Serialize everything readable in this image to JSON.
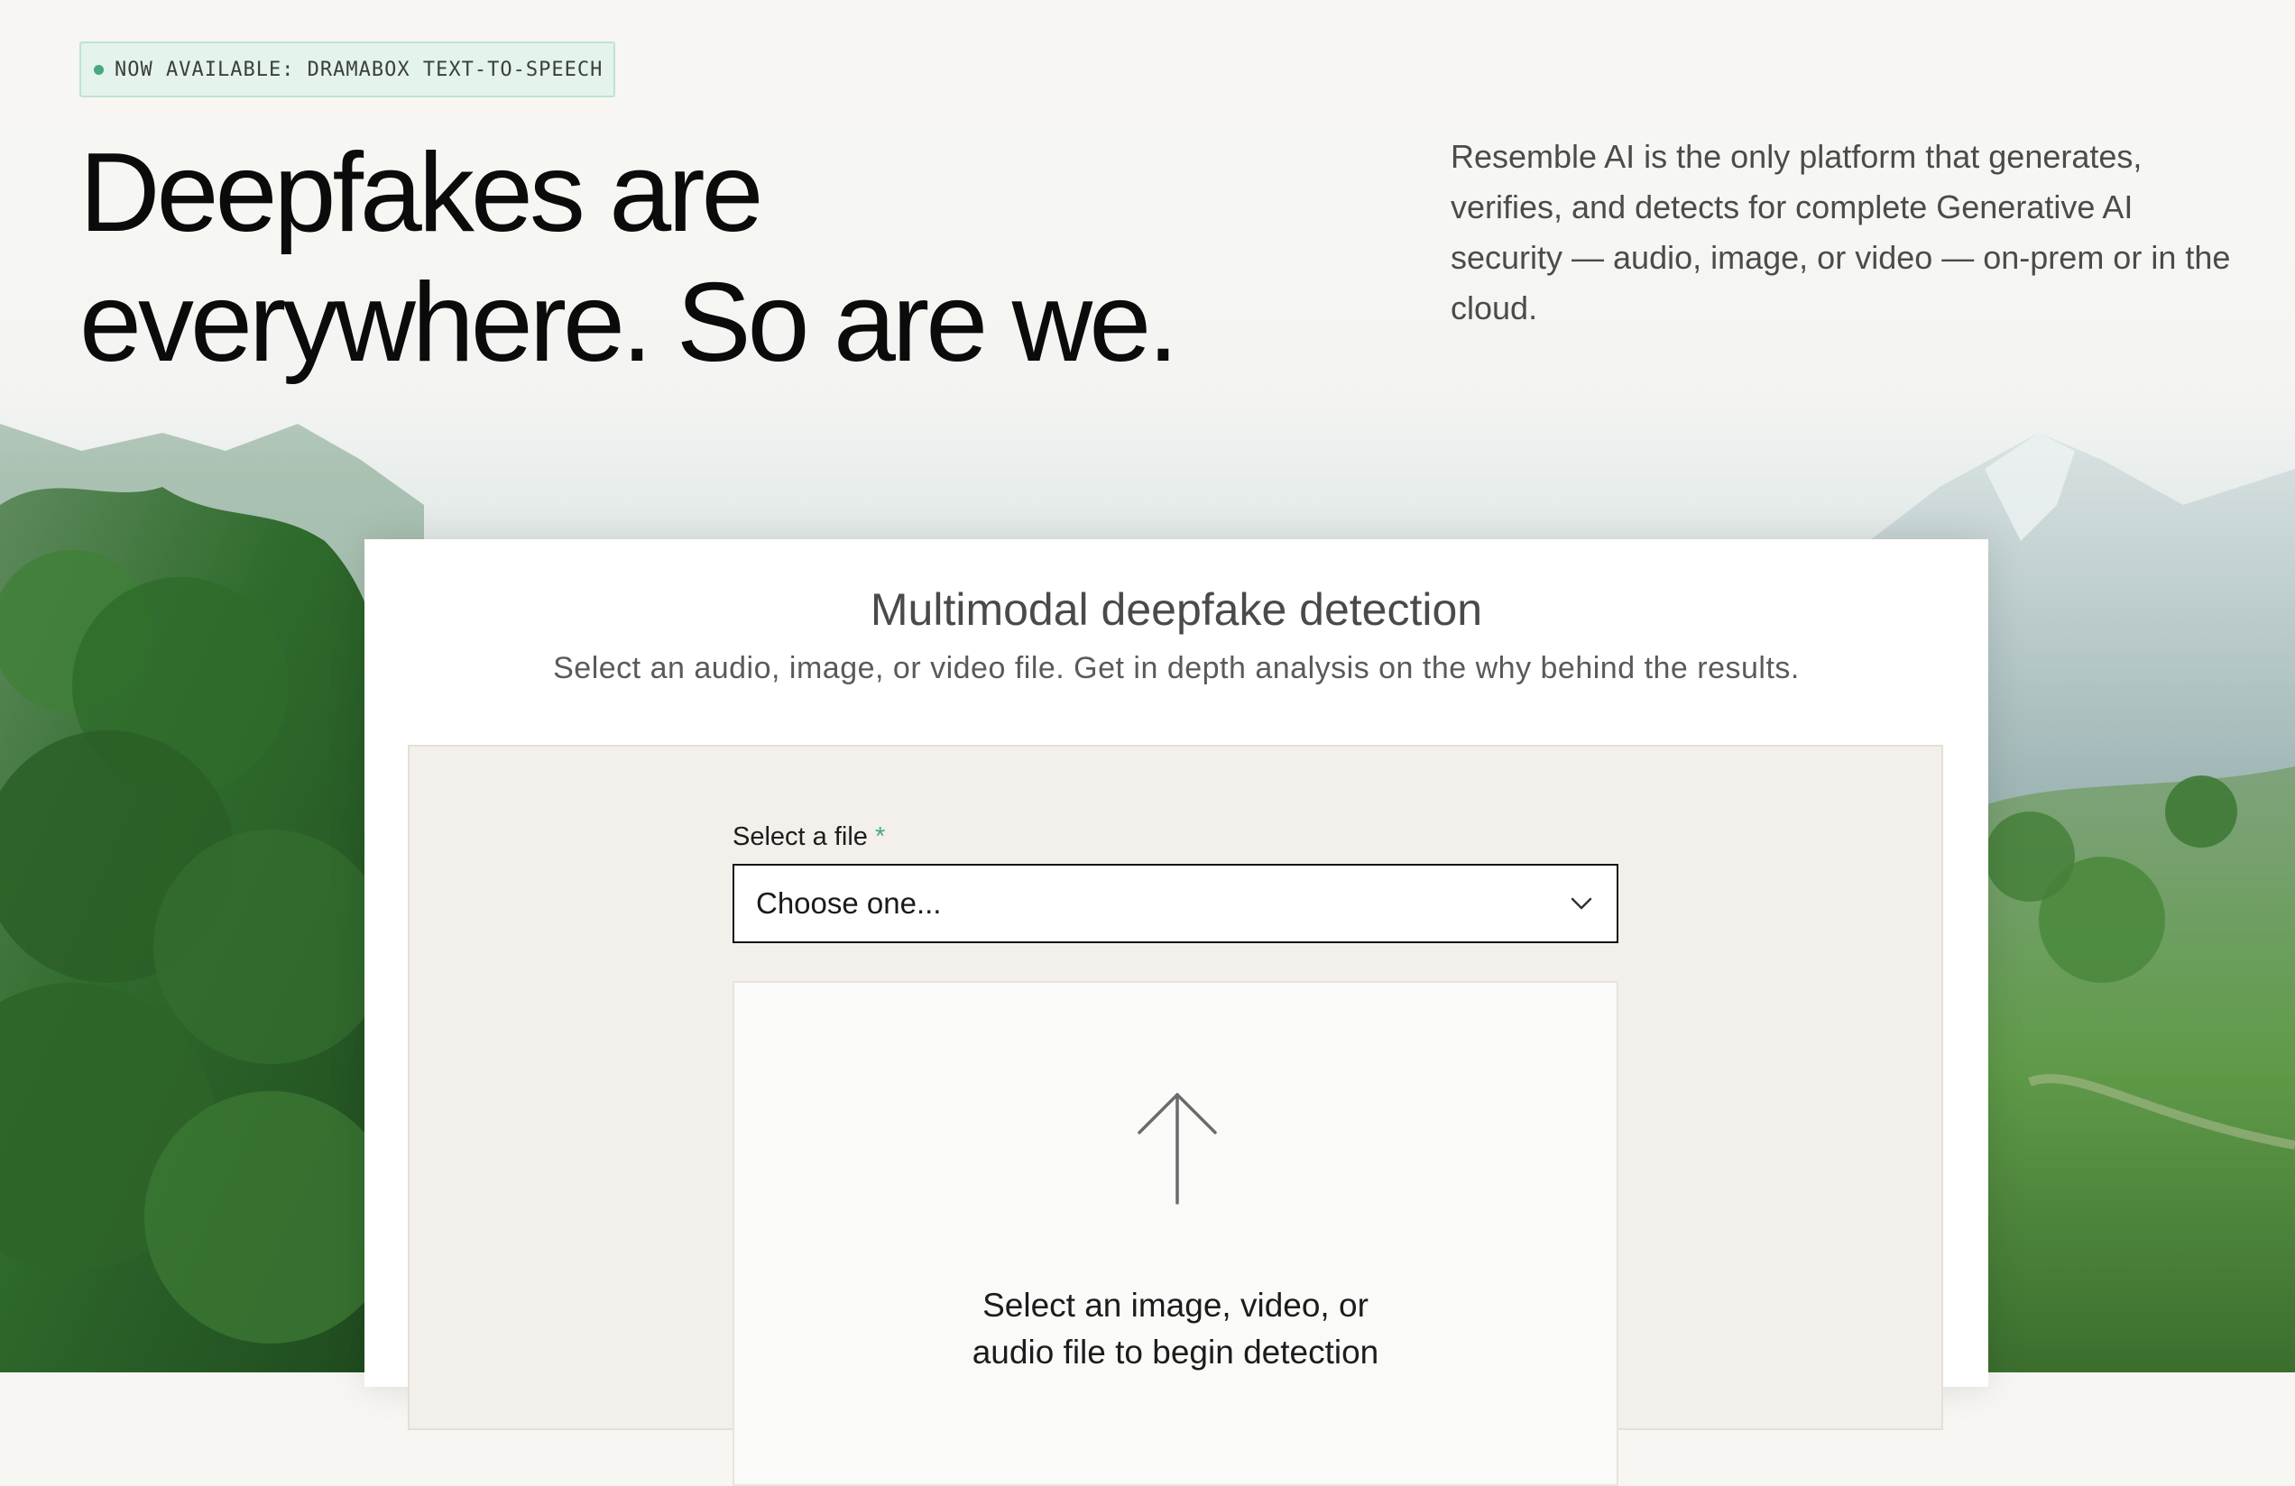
{
  "announcement": {
    "text": "NOW AVAILABLE: DRAMABOX TEXT-TO-SPEECH",
    "dot_color": "#4aa77f"
  },
  "hero": {
    "headline_line1": "Deepfakes are",
    "headline_line2": "everywhere. So are we.",
    "description": "Resemble AI is the only platform that generates, verifies, and detects for complete Generative AI security — audio, image, or video — on-prem or in the cloud."
  },
  "detection_card": {
    "title": "Multimodal deepfake detection",
    "subtitle": "Select an audio, image, or video file. Get in depth analysis on the why behind the results.",
    "file_select": {
      "label": "Select a file",
      "required_marker": "*",
      "value": "Choose one...",
      "icon": "chevron-down-icon"
    },
    "dropzone": {
      "icon": "upload-arrow-icon",
      "text_line1": "Select an image, video, or",
      "text_line2": "audio file to begin detection"
    }
  },
  "colors": {
    "accent_green": "#4aa77f",
    "background": "#f7f6f3",
    "panel": "#f3f0eb",
    "headline": "#0b0b0b"
  }
}
